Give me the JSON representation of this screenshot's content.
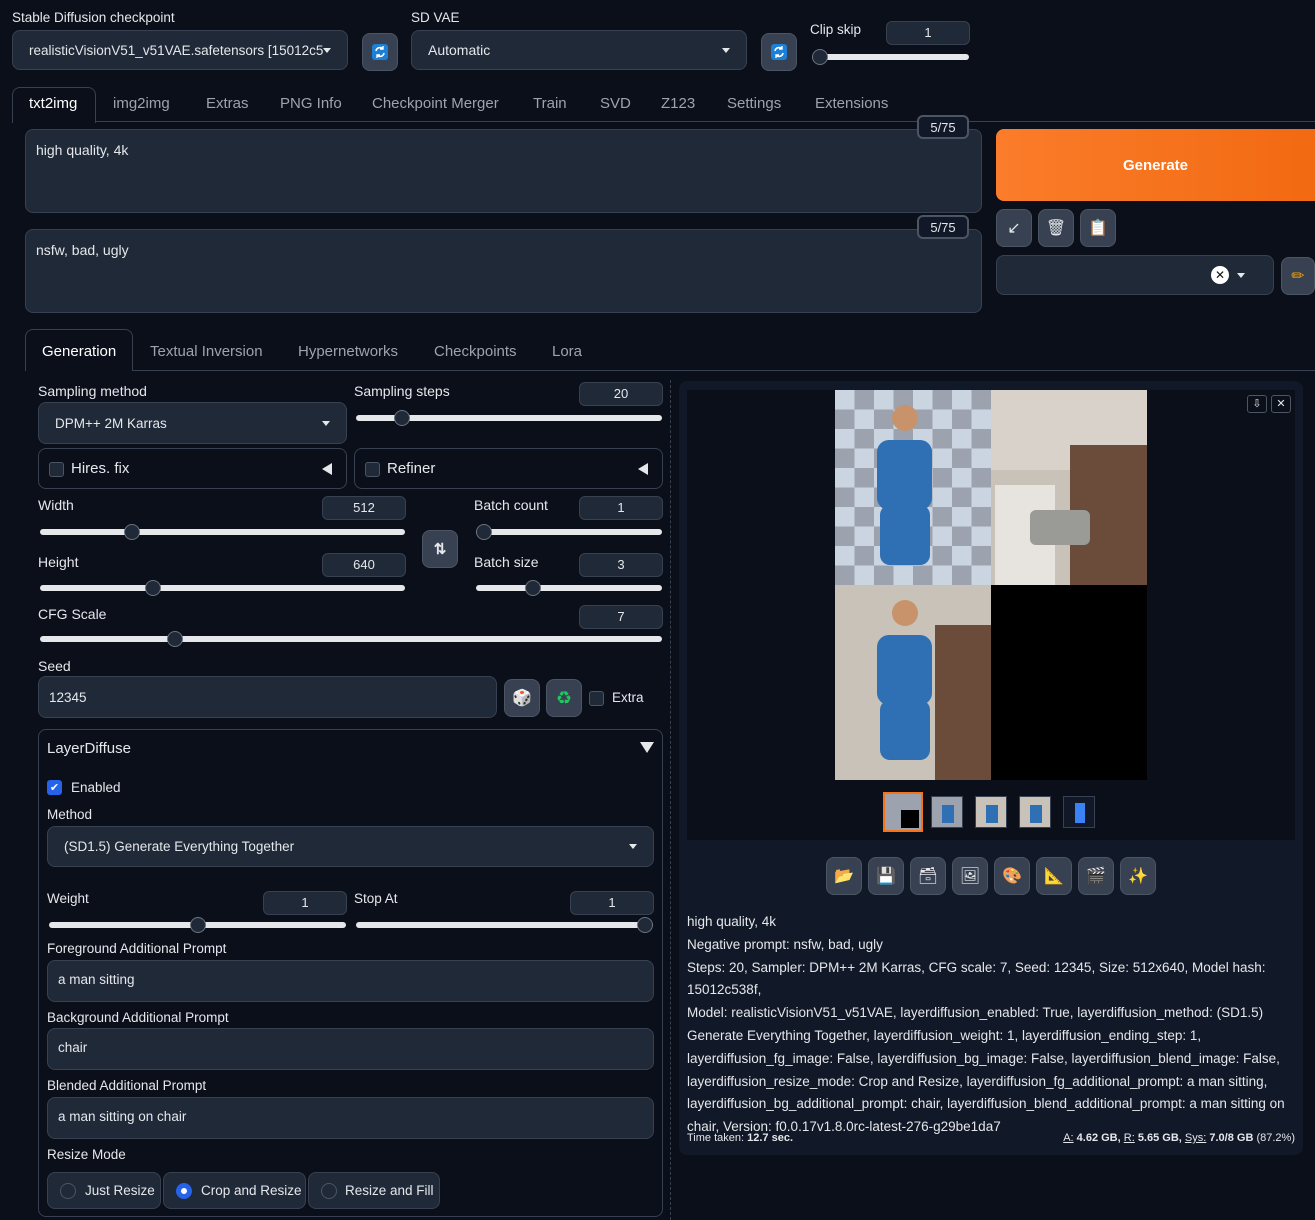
{
  "top": {
    "checkpoint_label": "Stable Diffusion checkpoint",
    "checkpoint_value": "realisticVisionV51_v51VAE.safetensors [15012c5",
    "vae_label": "SD VAE",
    "vae_value": "Automatic",
    "clip_label": "Clip skip",
    "clip_value": "1",
    "clip_fraction": 0.0
  },
  "main_tabs": [
    "txt2img",
    "img2img",
    "Extras",
    "PNG Info",
    "Checkpoint Merger",
    "Train",
    "SVD",
    "Z123",
    "Settings",
    "Extensions"
  ],
  "prompt": {
    "value": "high quality, 4k",
    "counter": "5/75"
  },
  "negative": {
    "value": "nsfw, bad, ugly",
    "counter": "5/75"
  },
  "generate_label": "Generate",
  "sub_tabs": [
    "Generation",
    "Textual Inversion",
    "Hypernetworks",
    "Checkpoints",
    "Lora"
  ],
  "sampling": {
    "method_label": "Sampling method",
    "method_value": "DPM++ 2M Karras",
    "steps_label": "Sampling steps",
    "steps_value": "20",
    "steps_fraction": 0.13
  },
  "hires_label": "Hires. fix",
  "refiner_label": "Refiner",
  "width": {
    "label": "Width",
    "value": "512",
    "fraction": 0.24
  },
  "height": {
    "label": "Height",
    "value": "640",
    "fraction": 0.3
  },
  "batch_count": {
    "label": "Batch count",
    "value": "1",
    "fraction": 0.0
  },
  "batch_size": {
    "label": "Batch size",
    "value": "3",
    "fraction": 0.29
  },
  "cfg": {
    "label": "CFG Scale",
    "value": "7",
    "fraction": 0.21
  },
  "seed": {
    "label": "Seed",
    "value": "12345",
    "extra_label": "Extra"
  },
  "layerdiffuse": {
    "title": "LayerDiffuse",
    "enabled_label": "Enabled",
    "method_label": "Method",
    "method_value": "(SD1.5) Generate Everything Together",
    "weight_label": "Weight",
    "weight_value": "1",
    "weight_fraction": 0.5,
    "stop_label": "Stop At",
    "stop_value": "1",
    "stop_fraction": 1.0,
    "fg_label": "Foreground Additional Prompt",
    "fg_value": "a man sitting",
    "bg_label": "Background Additional Prompt",
    "bg_value": "chair",
    "blend_label": "Blended Additional Prompt",
    "blend_value": "a man sitting on chair",
    "resize_label": "Resize Mode",
    "resize_options": [
      "Just Resize",
      "Crop and Resize",
      "Resize and Fill"
    ],
    "resize_selected": "Crop and Resize"
  },
  "output": {
    "line1": "high quality, 4k",
    "line2": "Negative prompt: nsfw, bad, ugly",
    "line3": "Steps: 20, Sampler: DPM++ 2M Karras, CFG scale: 7, Seed: 12345, Size: 512x640, Model hash: 15012c538f,",
    "line4": "Model: realisticVisionV51_v51VAE, layerdiffusion_enabled: True, layerdiffusion_method: (SD1.5)",
    "line5": "Generate Everything Together, layerdiffusion_weight: 1, layerdiffusion_ending_step: 1,",
    "line6": "layerdiffusion_fg_image: False, layerdiffusion_bg_image: False, layerdiffusion_blend_image: False,",
    "line7": "layerdiffusion_resize_mode: Crop and Resize, layerdiffusion_fg_additional_prompt: a man sitting,",
    "line8": "layerdiffusion_bg_additional_prompt: chair, layerdiffusion_blend_additional_prompt: a man sitting on",
    "line9": "chair, Version: f0.0.17v1.8.0rc-latest-276-g29be1da7",
    "time_prefix": "Time taken: ",
    "time_value": "12.7 sec.",
    "mem_a_label": "A:",
    "mem_a": "4.62 GB,",
    "mem_r_label": "R:",
    "mem_r": "5.65 GB,",
    "mem_sys_label": "Sys:",
    "mem_sys": "7.0/8 GB",
    "mem_pct": "(87.2%)"
  },
  "colors": {
    "accent": "#f97316",
    "bg": "#0b0f19",
    "panel": "#1f2937"
  }
}
